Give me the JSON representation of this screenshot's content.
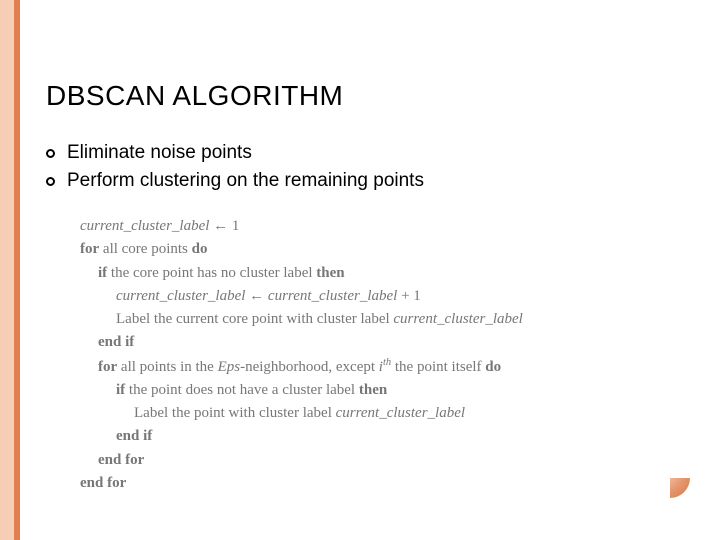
{
  "title": "DBSCAN ALGORITHM",
  "bullets": [
    "Eliminate noise points",
    "Perform clustering on the remaining points"
  ],
  "algo": {
    "var_ccl": "current_cluster_label",
    "var_eps": "Eps",
    "var_i": "i",
    "var_th": "th",
    "assign": "←",
    "one": "1",
    "plus1": "+ 1",
    "kw_for": "for",
    "kw_do": "do",
    "kw_if": "if",
    "kw_then": "then",
    "kw_endif": "end if",
    "kw_endfor": "end for",
    "txt_all_core": "all core points",
    "txt_if_no_label": "the core point has no cluster label",
    "txt_label_core": "Label the current core point with cluster label",
    "txt_all_eps_a": "all points in the",
    "txt_all_eps_b": "-neighborhood, except",
    "txt_all_eps_c": "the point itself",
    "txt_if_pt_no_label": "the point does not have a cluster label",
    "txt_label_pt": "Label the point with cluster label"
  }
}
